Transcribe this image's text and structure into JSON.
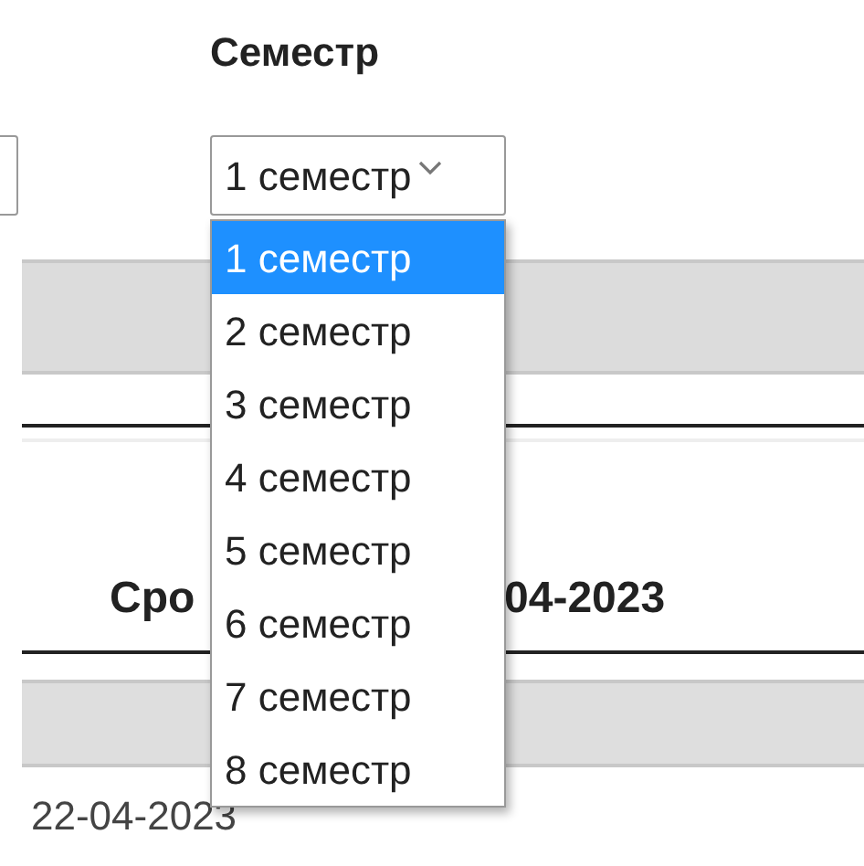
{
  "semester_label": "Семестр",
  "semester_select": {
    "value": "1 семестр"
  },
  "semester_options": [
    {
      "label": "1 семестр",
      "selected": true
    },
    {
      "label": "2 семестр",
      "selected": false
    },
    {
      "label": "3 семестр",
      "selected": false
    },
    {
      "label": "4 семестр",
      "selected": false
    },
    {
      "label": "5 семестр",
      "selected": false
    },
    {
      "label": "6 семестр",
      "selected": false
    },
    {
      "label": "7 семестр",
      "selected": false
    },
    {
      "label": "8 семестр",
      "selected": false
    }
  ],
  "section_heading": {
    "start": "Сро",
    "end": "04-2023"
  },
  "date_text": "22-04-2023"
}
